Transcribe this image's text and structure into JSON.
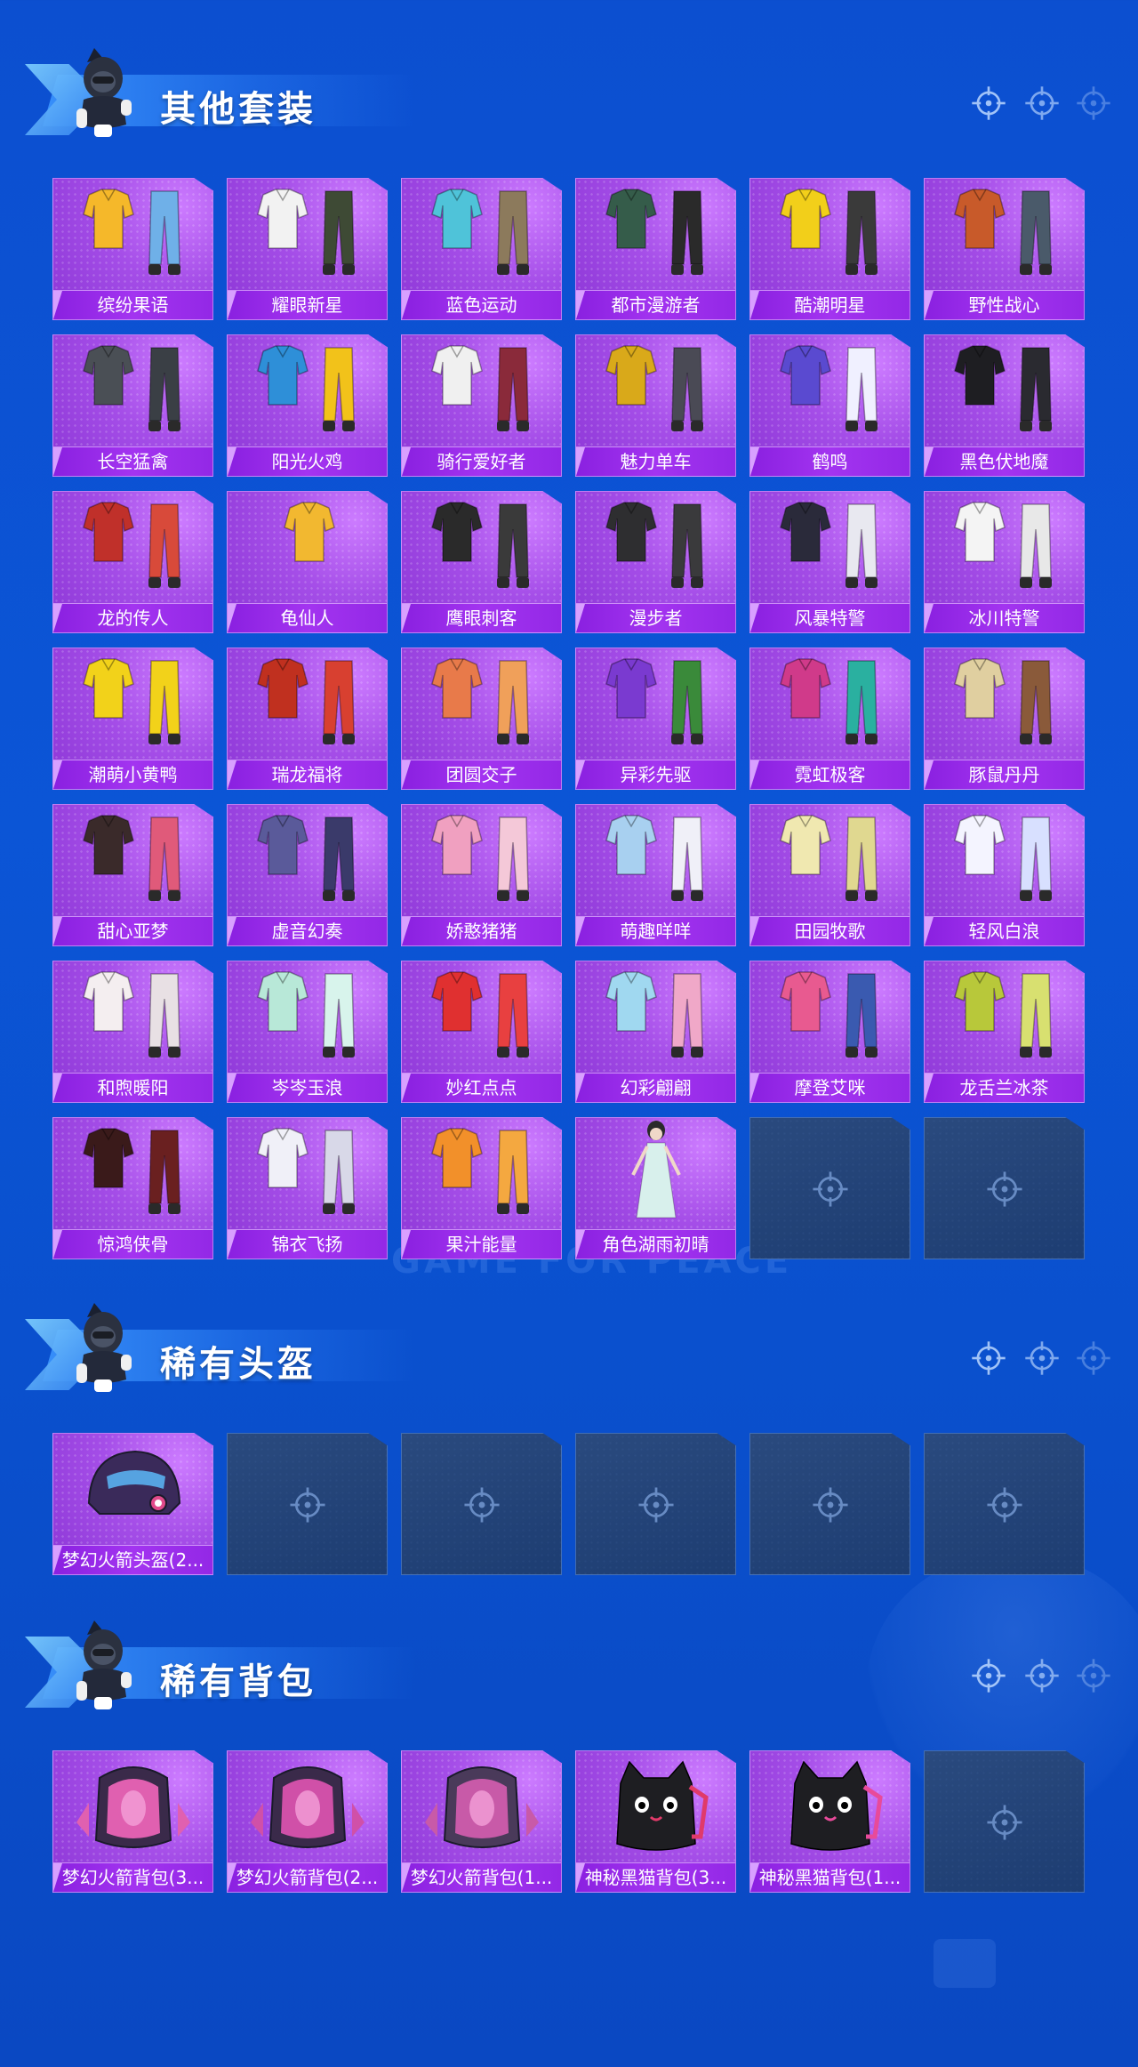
{
  "watermark": "GAME FOR PEACE",
  "sections": [
    {
      "title": "其他套装",
      "items": [
        {
          "name": "缤纷果语",
          "art": "outfit",
          "colors": [
            "#f5b82a",
            "#6fb0e8"
          ]
        },
        {
          "name": "耀眼新星",
          "art": "outfit",
          "colors": [
            "#f2f2f2",
            "#3e4a35"
          ]
        },
        {
          "name": "蓝色运动",
          "art": "outfit",
          "colors": [
            "#4fc3d9",
            "#8c7a5c"
          ]
        },
        {
          "name": "都市漫游者",
          "art": "outfit",
          "colors": [
            "#355c4a",
            "#2a2a2a"
          ]
        },
        {
          "name": "酷潮明星",
          "art": "outfit",
          "colors": [
            "#f2cf1a",
            "#3a3a3a"
          ]
        },
        {
          "name": "野性战心",
          "art": "outfit",
          "colors": [
            "#c85a2a",
            "#4a5a6a"
          ]
        },
        {
          "name": "长空猛禽",
          "art": "outfit",
          "colors": [
            "#4a4f55",
            "#3a3f45"
          ]
        },
        {
          "name": "阳光火鸡",
          "art": "outfit",
          "colors": [
            "#2e8fd8",
            "#f2c21a"
          ]
        },
        {
          "name": "骑行爱好者",
          "art": "outfit",
          "colors": [
            "#f0f0f0",
            "#8a2a3a"
          ]
        },
        {
          "name": "魅力单车",
          "art": "outfit",
          "colors": [
            "#d9a91a",
            "#4a4a55"
          ]
        },
        {
          "name": "鹤鸣",
          "art": "outfit",
          "colors": [
            "#5a4ad0",
            "#f0f0ff"
          ]
        },
        {
          "name": "黑色伏地魔",
          "art": "outfit",
          "colors": [
            "#1e1e22",
            "#2a2a30"
          ]
        },
        {
          "name": "龙的传人",
          "art": "outfit",
          "colors": [
            "#c0302a",
            "#d84a3a"
          ]
        },
        {
          "name": "龟仙人",
          "art": "shirt",
          "colors": [
            "#f2b830",
            "#f2b830"
          ]
        },
        {
          "name": "鹰眼刺客",
          "art": "outfit",
          "colors": [
            "#2a2a2a",
            "#3a3a3a"
          ]
        },
        {
          "name": "漫步者",
          "art": "outfit",
          "colors": [
            "#2e2e30",
            "#3a3a3c"
          ]
        },
        {
          "name": "风暴特警",
          "art": "outfit",
          "colors": [
            "#2a2a3a",
            "#e8e8f0"
          ]
        },
        {
          "name": "冰川特警",
          "art": "outfit",
          "colors": [
            "#f4f4f4",
            "#e8e8e8"
          ]
        },
        {
          "name": "潮萌小黄鸭",
          "art": "outfit",
          "colors": [
            "#f2d21a",
            "#f2d21a"
          ]
        },
        {
          "name": "瑞龙福将",
          "art": "outfit",
          "colors": [
            "#c0301f",
            "#d84030"
          ]
        },
        {
          "name": "团圆交子",
          "art": "outfit",
          "colors": [
            "#e87a4a",
            "#f0a05a"
          ]
        },
        {
          "name": "异彩先驱",
          "art": "outfit",
          "colors": [
            "#7a3ad0",
            "#3a8a3a"
          ]
        },
        {
          "name": "霓虹极客",
          "art": "outfit",
          "colors": [
            "#d03a8a",
            "#2ab0a0"
          ]
        },
        {
          "name": "豚鼠丹丹",
          "art": "outfit",
          "colors": [
            "#e0cfa0",
            "#8a5a3a"
          ]
        },
        {
          "name": "甜心亚梦",
          "art": "outfit",
          "colors": [
            "#3a2a2a",
            "#e05a7a"
          ]
        },
        {
          "name": "虚音幻奏",
          "art": "outfit",
          "colors": [
            "#5a5a9a",
            "#3a3a6a"
          ]
        },
        {
          "name": "娇憨猪猪",
          "art": "outfit",
          "colors": [
            "#f0a0c0",
            "#f4c8d8"
          ]
        },
        {
          "name": "萌趣咩咩",
          "art": "outfit",
          "colors": [
            "#a8d0f0",
            "#f0f0f8"
          ]
        },
        {
          "name": "田园牧歌",
          "art": "outfit",
          "colors": [
            "#f0e8b0",
            "#e0d890"
          ]
        },
        {
          "name": "轻风白浪",
          "art": "outfit",
          "colors": [
            "#f4f4ff",
            "#d8e0ff"
          ]
        },
        {
          "name": "和煦暖阳",
          "art": "outfit",
          "colors": [
            "#f4eef0",
            "#e8e0e4"
          ]
        },
        {
          "name": "岑岑玉浪",
          "art": "outfit",
          "colors": [
            "#b8e8d8",
            "#d8f4ec"
          ]
        },
        {
          "name": "妙红点点",
          "art": "outfit",
          "colors": [
            "#e03030",
            "#e84040"
          ]
        },
        {
          "name": "幻彩翩翩",
          "art": "outfit",
          "colors": [
            "#a0d8f0",
            "#f0a8c8"
          ]
        },
        {
          "name": "摩登艾咪",
          "art": "outfit",
          "colors": [
            "#e85a90",
            "#3a5ab0"
          ]
        },
        {
          "name": "龙舌兰冰茶",
          "art": "outfit",
          "colors": [
            "#b8c83a",
            "#d8e070"
          ]
        },
        {
          "name": "惊鸿侠骨",
          "art": "outfit",
          "colors": [
            "#3a1a1a",
            "#6a2020"
          ]
        },
        {
          "name": "锦衣飞扬",
          "art": "outfit",
          "colors": [
            "#f0f0f8",
            "#d8d8e8"
          ]
        },
        {
          "name": "果汁能量",
          "art": "outfit",
          "colors": [
            "#f2902a",
            "#f4a840"
          ]
        },
        {
          "name": "角色湖雨初晴",
          "art": "character",
          "colors": [
            "#d8f0ec",
            "#2a2a2a"
          ]
        },
        {
          "name": "",
          "art": "empty"
        },
        {
          "name": "",
          "art": "empty"
        }
      ]
    },
    {
      "title": "稀有头盔",
      "items": [
        {
          "name": "梦幻火箭头盔(2...",
          "art": "helmet",
          "colors": [
            "#3a2a5a",
            "#e04a8a"
          ]
        },
        {
          "name": "",
          "art": "empty"
        },
        {
          "name": "",
          "art": "empty"
        },
        {
          "name": "",
          "art": "empty"
        },
        {
          "name": "",
          "art": "empty"
        },
        {
          "name": "",
          "art": "empty"
        }
      ]
    },
    {
      "title": "稀有背包",
      "items": [
        {
          "name": "梦幻火箭背包(3...",
          "art": "backpack",
          "colors": [
            "#e060b0",
            "#3a2a4a"
          ]
        },
        {
          "name": "梦幻火箭背包(2...",
          "art": "backpack",
          "colors": [
            "#d050a8",
            "#3a2a4a"
          ]
        },
        {
          "name": "梦幻火箭背包(1...",
          "art": "backpack",
          "colors": [
            "#c85aa8",
            "#4a3a5a"
          ]
        },
        {
          "name": "神秘黑猫背包(3...",
          "art": "catpack",
          "colors": [
            "#1e1e22",
            "#e03a6a"
          ]
        },
        {
          "name": "神秘黑猫背包(1...",
          "art": "catpack",
          "colors": [
            "#1e1e22",
            "#e84a9a"
          ]
        },
        {
          "name": "",
          "art": "empty"
        }
      ]
    }
  ]
}
